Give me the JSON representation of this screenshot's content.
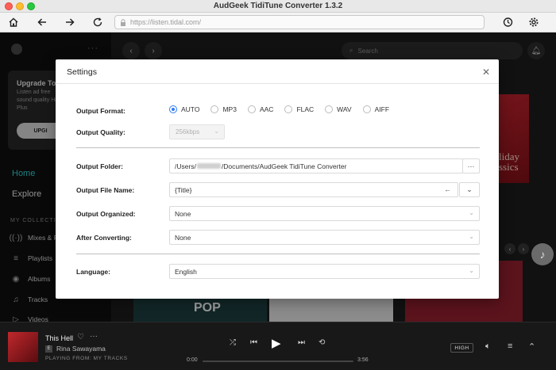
{
  "window": {
    "title": "AudGeek TidiTune Converter 1.3.2"
  },
  "toolbar": {
    "url": "https://listen.tidal.com/"
  },
  "sidebar": {
    "dots": "···",
    "upgrade": {
      "title": "Upgrade Tod",
      "desc": "Listen ad free sound quality HiFi Plus",
      "button": "UPGI"
    },
    "nav": {
      "home": "Home",
      "explore": "Explore"
    },
    "collection_head": "MY COLLECTIO",
    "collection": [
      {
        "label": "Mixes & F",
        "icon": "radio-icon"
      },
      {
        "label": "Playlists",
        "icon": "playlist-icon"
      },
      {
        "label": "Albums",
        "icon": "album-icon"
      },
      {
        "label": "Tracks",
        "icon": "music-note-icon"
      },
      {
        "label": "Videos",
        "icon": "video-icon"
      }
    ]
  },
  "main": {
    "search_placeholder": "Search",
    "art_red_text": "liday ssics",
    "pop_text": "POP"
  },
  "settings": {
    "title": "Settings",
    "output_format": {
      "label": "Output Format:",
      "options": [
        "AUTO",
        "MP3",
        "AAC",
        "FLAC",
        "WAV",
        "AIFF"
      ],
      "selected": "AUTO"
    },
    "output_quality": {
      "label": "Output Quality:",
      "value": "256kbps"
    },
    "output_folder": {
      "label": "Output Folder:",
      "prefix": "/Users/",
      "suffix": "/Documents/AudGeek TidiTune Converter",
      "browse": "···"
    },
    "output_file_name": {
      "label": "Output File Name:",
      "value": "{Title}"
    },
    "output_organized": {
      "label": "Output Organized:",
      "value": "None"
    },
    "after_converting": {
      "label": "After Converting:",
      "value": "None"
    },
    "language": {
      "label": "Language:",
      "value": "English"
    }
  },
  "player": {
    "track": "This Hell",
    "artist": "Rina Sawayama",
    "explicit": "E",
    "playing_from": "PLAYING FROM: MY TRACKS",
    "time_current": "0:00",
    "time_total": "3:56",
    "quality": "HIGH"
  },
  "colors": {
    "accent": "#2f7bf5",
    "home_active": "#2ec4c4"
  }
}
